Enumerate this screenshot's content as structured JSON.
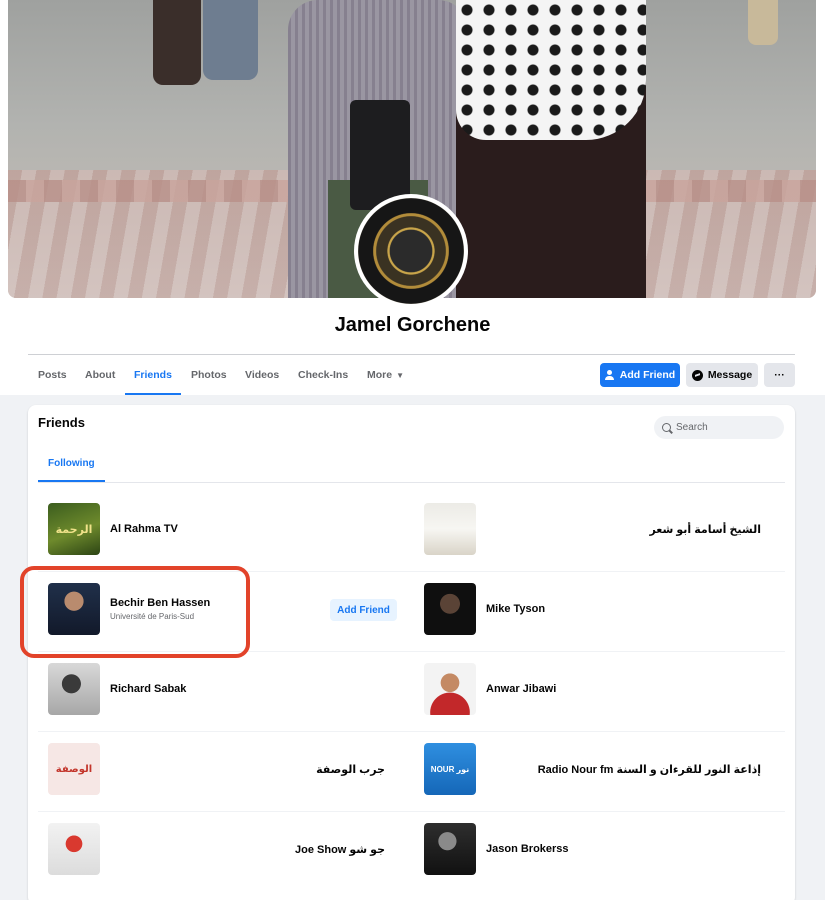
{
  "profile": {
    "name": "Jamel Gorchene"
  },
  "nav": {
    "tabs": [
      "Posts",
      "About",
      "Friends",
      "Photos",
      "Videos",
      "Check-Ins",
      "More"
    ],
    "active_tab": "Friends",
    "add_friend_label": "Add Friend",
    "message_label": "Message",
    "more_options_label": "···"
  },
  "friends_card": {
    "title": "Friends",
    "search_placeholder": "Search",
    "active_tab": "Following",
    "add_friend_label": "Add Friend",
    "items": [
      {
        "name": "Al Rahma TV",
        "subtitle": "",
        "thumb_text": "الرحمة"
      },
      {
        "name": "الشيخ أسامة أبو شعر",
        "subtitle": "",
        "thumb_text": ""
      },
      {
        "name": "Bechir Ben Hassen",
        "subtitle": "Université de Paris-Sud",
        "thumb_text": ""
      },
      {
        "name": "Mike Tyson",
        "subtitle": "",
        "thumb_text": ""
      },
      {
        "name": "Richard Sabak",
        "subtitle": "",
        "thumb_text": ""
      },
      {
        "name": "Anwar Jibawi",
        "subtitle": "",
        "thumb_text": ""
      },
      {
        "name": "جرب الوصفة",
        "subtitle": "",
        "thumb_text": "الوصفة"
      },
      {
        "name": "إذاعة النور للقرءان و السنة Radio Nour fm",
        "subtitle": "",
        "thumb_text": "NOUR نور"
      },
      {
        "name": "جو شو Joe Show",
        "subtitle": "",
        "thumb_text": ""
      },
      {
        "name": "Jason Brokerss",
        "subtitle": "",
        "thumb_text": ""
      }
    ]
  },
  "colors": {
    "accent": "#1877f2",
    "highlight": "#e2432a",
    "background": "#f0f2f5"
  }
}
